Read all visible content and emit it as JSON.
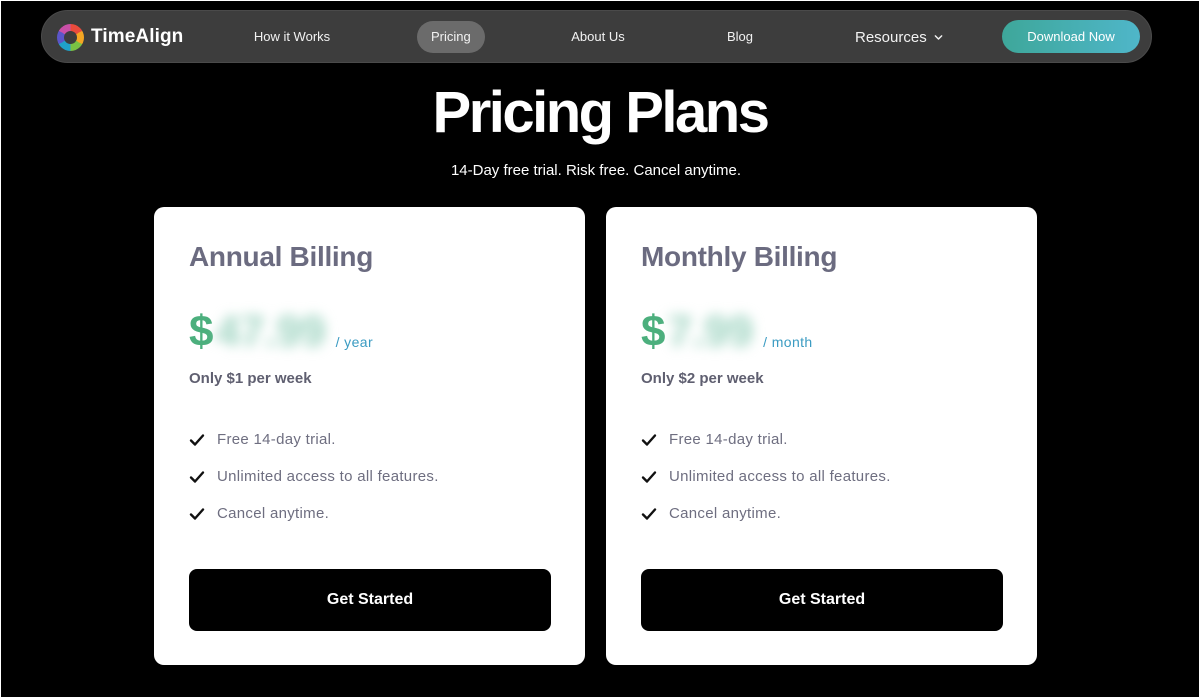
{
  "nav": {
    "brand": "TimeAlign",
    "links": [
      "How it Works",
      "Pricing",
      "About Us",
      "Blog"
    ],
    "resources_label": "Resources",
    "download_label": "Download Now"
  },
  "hero": {
    "title": "Pricing Plans",
    "subtitle": "14-Day free trial. Risk free. Cancel anytime."
  },
  "plans": [
    {
      "title": "Annual Billing",
      "currency": "$",
      "amount": "47.99",
      "period": "/ year",
      "per_week": "Only $1 per week",
      "features": [
        "Free 14-day trial.",
        "Unlimited access to all features.",
        "Cancel anytime."
      ],
      "cta": "Get Started"
    },
    {
      "title": "Monthly Billing",
      "currency": "$",
      "amount": "7.99",
      "period": "/ month",
      "per_week": "Only $2 per week",
      "features": [
        "Free 14-day trial.",
        "Unlimited access to all features.",
        "Cancel anytime."
      ],
      "cta": "Get Started"
    }
  ],
  "colors": {
    "background": "#000000",
    "nav_bg": "#3d3d3d",
    "price_green": "#4caf7d",
    "period_blue": "#3a9bc2",
    "cta_bg": "#000000",
    "download_gradient": [
      "#3ea79a",
      "#4fb6c9"
    ]
  },
  "icons": {
    "brand": "timealign-logo-icon",
    "resources": "chevron-down-icon",
    "feature": "check-icon"
  }
}
